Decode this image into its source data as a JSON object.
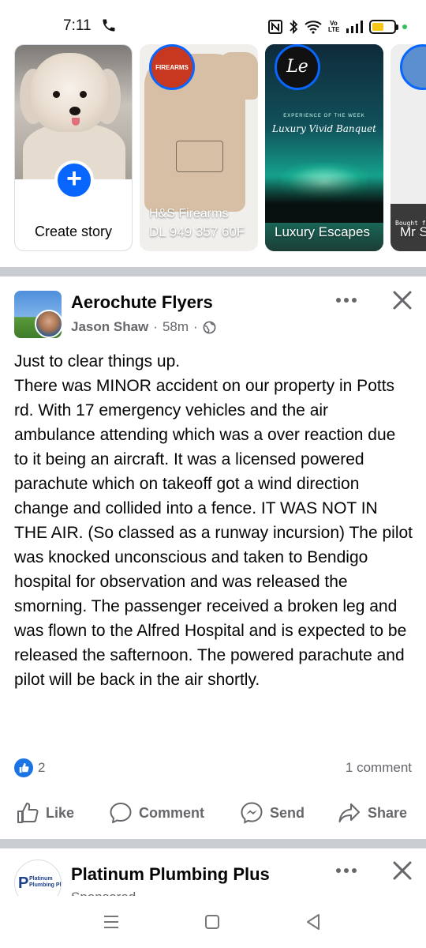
{
  "status_bar": {
    "time": "7:11",
    "volte": "Vo LTE",
    "battery_level": 0.55,
    "battery_color": "#f5c518"
  },
  "stories": {
    "create_label": "Create story",
    "items": [
      {
        "line1": "H&S Firearms",
        "line2": "DL 949 357 60F",
        "avatar_text": "FIREARMS"
      },
      {
        "label": "Luxury Escapes",
        "avatar_text": "Le",
        "title": "Luxury Vivid Banquet",
        "sub": "EXPERIENCE OF THE WEEK"
      },
      {
        "label": "Mr S",
        "caption": "Bought from @"
      }
    ]
  },
  "post": {
    "page_name": "Aerochute Flyers",
    "author": "Jason Shaw",
    "time": "58m",
    "body": "Just to clear things up.\nThere was MINOR accident on our property in Potts rd. With 17 emergency vehicles and the air ambulance attending which was a over reaction due to it being an aircraft. It was a licensed powered parachute which on takeoff got a wind direction change and collided into a fence. IT WAS NOT IN THE AIR. (So classed as a runway incursion) The pilot was knocked unconscious and taken to Bendigo hospital for observation and was released the smorning. The passenger received a broken leg and was flown to the Alfred Hospital and is expected to be released the safternoon. The powered parachute and pilot will be back in the air shortly.",
    "reaction_count": "2",
    "comment_count": "1 comment",
    "actions": {
      "like": "Like",
      "comment": "Comment",
      "send": "Send",
      "share": "Share"
    }
  },
  "next_post": {
    "page_name": "Platinum Plumbing Plus",
    "sub": "Sponsored",
    "logo_letter": "P",
    "logo_text": "Platinum\nPlumbing Plus"
  },
  "colors": {
    "accent": "#0866ff",
    "secondary_text": "#65676b",
    "divider": "#c9ccd1"
  }
}
